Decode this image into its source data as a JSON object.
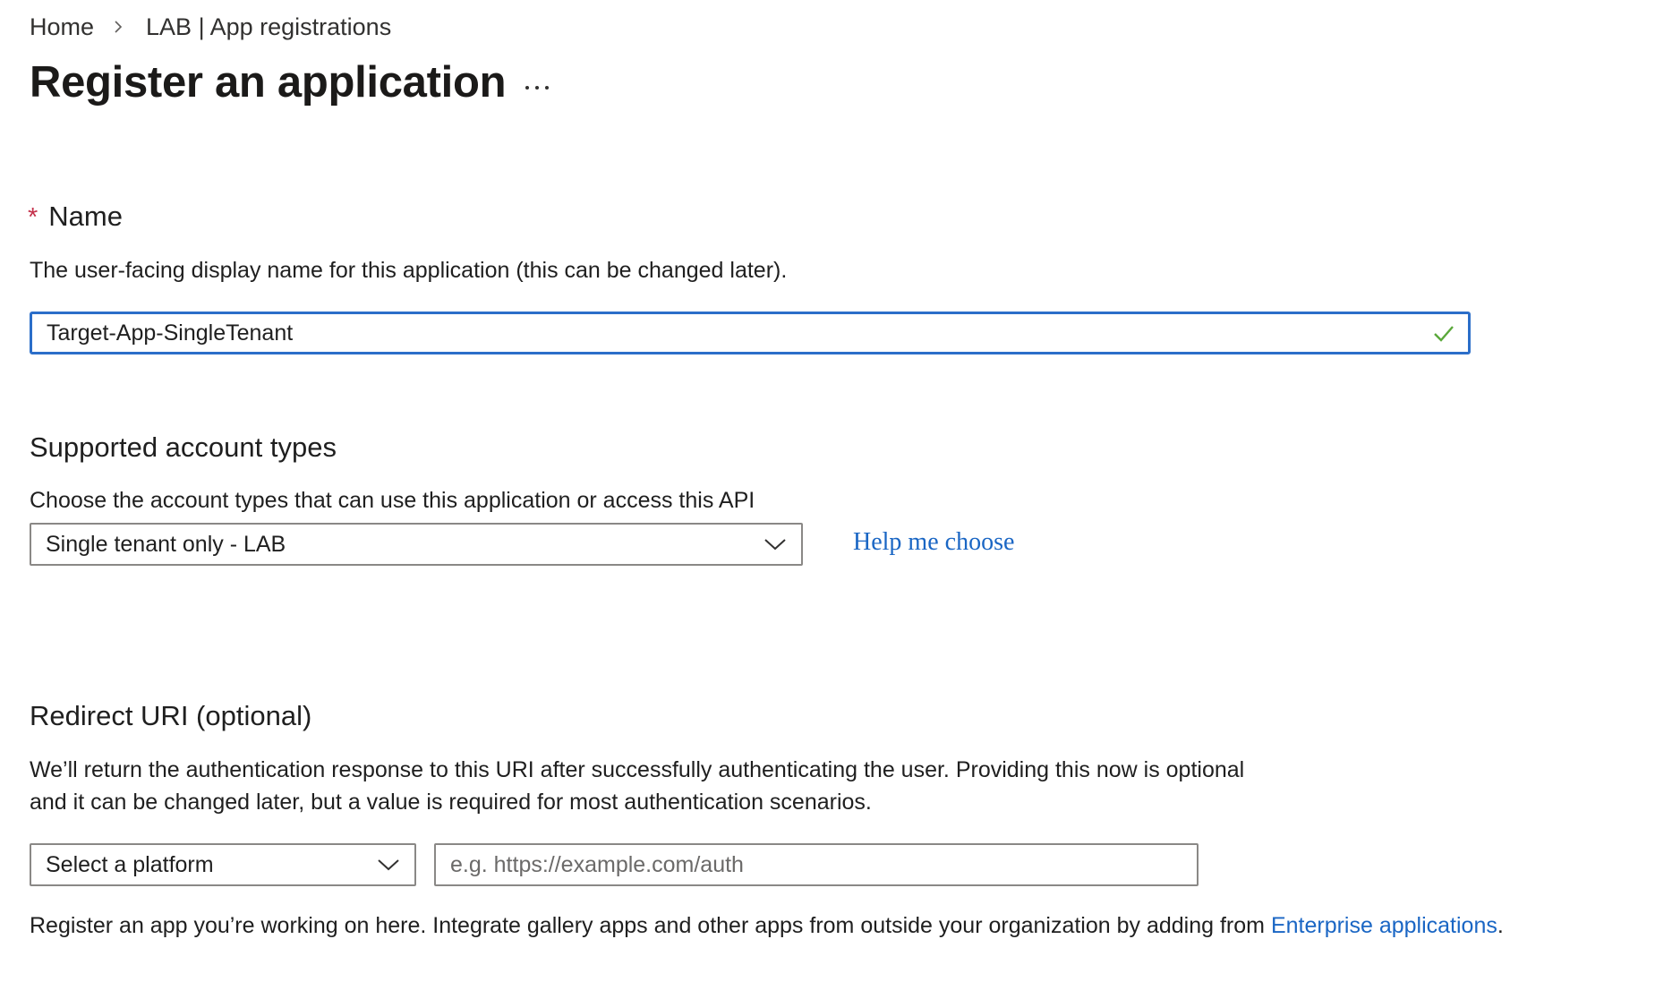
{
  "breadcrumb": {
    "home": "Home",
    "current": "LAB | App registrations"
  },
  "page": {
    "title": "Register an application",
    "more_label": "···"
  },
  "name_section": {
    "required_mark": "*",
    "label": "Name",
    "description": "The user-facing display name for this application (this can be changed later).",
    "value": "Target-App-SingleTenant",
    "valid_icon": "checkmark-icon"
  },
  "account_types": {
    "heading": "Supported account types",
    "description": "Choose the account types that can use this application or access this API",
    "selected": "Single tenant only - LAB",
    "help_link": "Help me choose"
  },
  "redirect_uri": {
    "heading": "Redirect URI (optional)",
    "description": "We’ll return the authentication response to this URI after successfully authenticating the user. Providing this now is optional and it can be changed later, but a value is required for most authentication scenarios.",
    "platform_select": "Select a platform",
    "uri_value": "",
    "uri_placeholder": "e.g. https://example.com/auth"
  },
  "footer": {
    "text_before": "Register an app you’re working on here. Integrate gallery apps and other apps from outside your organization by adding from ",
    "link": "Enterprise applications",
    "text_after": "."
  },
  "colors": {
    "accent": "#2b6ec9",
    "link": "#1a66c4",
    "required": "#c4314b",
    "valid": "#5aa83a"
  }
}
